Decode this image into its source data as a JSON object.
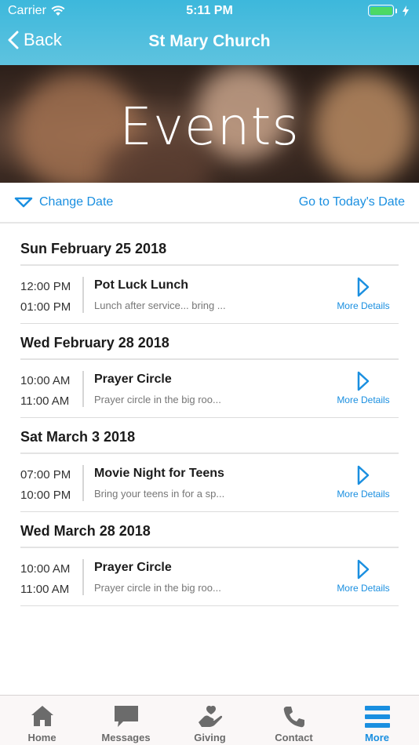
{
  "status_bar": {
    "carrier": "Carrier",
    "time": "5:11 PM"
  },
  "nav": {
    "back_label": "Back",
    "title": "St Mary Church"
  },
  "banner": {
    "title": "Events"
  },
  "date_bar": {
    "change_date": "Change Date",
    "today": "Go to Today's Date"
  },
  "days": [
    {
      "date": "Sun February 25 2018",
      "event": {
        "start": "12:00 PM",
        "end": "01:00 PM",
        "name": "Pot Luck Lunch",
        "desc": "Lunch after service... bring ...",
        "more": "More Details"
      }
    },
    {
      "date": "Wed February 28 2018",
      "event": {
        "start": "10:00 AM",
        "end": "11:00 AM",
        "name": "Prayer Circle",
        "desc": "Prayer circle in the big roo...",
        "more": "More Details"
      }
    },
    {
      "date": "Sat March 3 2018",
      "event": {
        "start": "07:00 PM",
        "end": "10:00 PM",
        "name": "Movie Night for Teens",
        "desc": "Bring your teens in for a sp...",
        "more": "More Details"
      }
    },
    {
      "date": "Wed March 28 2018",
      "event": {
        "start": "10:00 AM",
        "end": "11:00 AM",
        "name": "Prayer Circle",
        "desc": "Prayer circle in the big roo...",
        "more": "More Details"
      }
    }
  ],
  "tabs": [
    {
      "label": "Home",
      "icon": "home-icon"
    },
    {
      "label": "Messages",
      "icon": "messages-icon"
    },
    {
      "label": "Giving",
      "icon": "giving-icon"
    },
    {
      "label": "Contact",
      "icon": "phone-icon"
    },
    {
      "label": "More",
      "icon": "menu-icon",
      "active": true
    }
  ],
  "colors": {
    "header": "#3db8dc",
    "accent": "#1a8fe0",
    "battery": "#4cd964"
  }
}
